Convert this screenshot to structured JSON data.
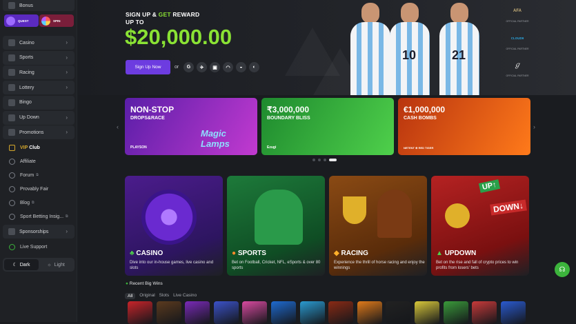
{
  "sidebar": {
    "bonus_label": "Bonus",
    "quest_label": "QUEST",
    "spin_label": "SPIN",
    "nav": [
      {
        "label": "Casino",
        "icon": "casino-icon"
      },
      {
        "label": "Sports",
        "icon": "sports-icon"
      },
      {
        "label": "Racing",
        "icon": "racing-icon"
      },
      {
        "label": "Lottery",
        "icon": "lottery-icon"
      },
      {
        "label": "Bingo",
        "icon": "bingo-icon"
      },
      {
        "label": "Up Down",
        "icon": "updown-icon"
      },
      {
        "label": "Promotions",
        "icon": "promotions-icon"
      }
    ],
    "vip_prefix": "VIP",
    "vip_suffix": "Club",
    "links": [
      {
        "label": "Affiliate"
      },
      {
        "label": "Forum"
      },
      {
        "label": "Provably Fair"
      },
      {
        "label": "Blog"
      },
      {
        "label": "Sport Betting Insig..."
      }
    ],
    "sponsorships_label": "Sponsorships",
    "live_support_label": "Live Support",
    "theme": {
      "dark": "Dark",
      "light": "Light"
    }
  },
  "hero": {
    "line1_a": "SIGN UP &",
    "line1_b": "GET",
    "line1_c": "REWARD",
    "line2": "UP TO",
    "amount": "$20,000.00",
    "signup_label": "Sign Up Now",
    "or_label": "or",
    "social": [
      "G",
      "✈",
      "▣",
      "◠",
      "◒",
      "◐"
    ],
    "players": [
      "10",
      "21"
    ],
    "partners": [
      {
        "text": "OFFICIAL PARTNER",
        "color": "#c9b27a"
      },
      {
        "text": "OFFICIAL PARTNER",
        "color": "#2aa7e0"
      },
      {
        "text": "OFFICIAL PARTNER",
        "color": "#d8d8d8"
      }
    ],
    "partner_marks": [
      "AFA",
      "CLOUD9"
    ]
  },
  "promos": [
    {
      "t1": "NON-STOP",
      "t2": "DROPS&RACE",
      "brand": "PLAYSON",
      "art": "Magic Lamps",
      "colors": [
        "#5a1ea8",
        "#c23ad0"
      ]
    },
    {
      "t1": "₹3,000,000",
      "t2": "BOUNDARY BLISS",
      "brand": "Ezugi",
      "art": "",
      "colors": [
        "#1e8a2e",
        "#4fd04b"
      ]
    },
    {
      "t1": "€1,000,000",
      "t2": "CASH BOMBS",
      "brand": "NETENT ⊕ RED TIGER",
      "art": "",
      "colors": [
        "#b8340f",
        "#ff7a1a"
      ]
    }
  ],
  "categories": [
    {
      "title": "CASINO",
      "desc": "Dive into our in-house games, live casino and slots",
      "colors": [
        "#4b1c8c",
        "#2d1560"
      ],
      "icon": "casino-icon"
    },
    {
      "title": "SPORTS",
      "desc": "Bet on Football, Cricket, NFL, eSports & over 80 sports",
      "colors": [
        "#1d7a3a",
        "#0f4d24"
      ],
      "icon": "sports-icon"
    },
    {
      "title": "RACING",
      "desc": "Experience the thrill of horse racing and enjoy the winnings",
      "colors": [
        "#8a4a14",
        "#5a2c0a"
      ],
      "icon": "racing-icon"
    },
    {
      "title": "UPDOWN",
      "desc": "Bet on the rise and fall of crypto prices to win profits from losers' bets",
      "colors": [
        "#b52222",
        "#7a1010"
      ],
      "icon": "updown-icon"
    }
  ],
  "big_wins": {
    "title": "Recent Big Wins",
    "tabs": [
      "All",
      "Original",
      "Slots",
      "Live Casino"
    ],
    "game_colors": [
      "#c8242a",
      "#5b3a1e",
      "#7a2ab8",
      "#3b52c9",
      "#d84aa0",
      "#1e6ad0",
      "#2a9ad0",
      "#8a2a14",
      "#e07a1a",
      "#222",
      "#d8c83a",
      "#3a9a3a",
      "#c83a3a",
      "#2a5ad0"
    ]
  },
  "colors": {
    "accent": "#6d3ce0",
    "amount": "#8ae234",
    "get": "#8ae234",
    "support": "#3cb43c"
  }
}
